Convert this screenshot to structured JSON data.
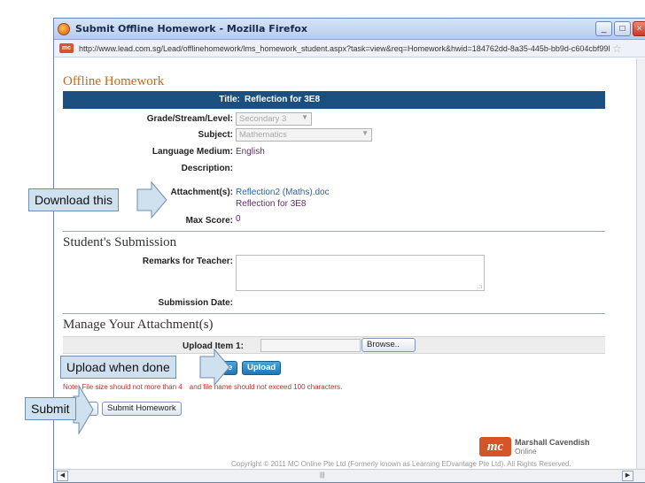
{
  "window": {
    "title": "Submit Offline Homework - Mozilla Firefox",
    "minimize_glyph": "_",
    "maximize_glyph": "□",
    "close_glyph": "×"
  },
  "address": {
    "site_badge": "mc",
    "url": "http://www.lead.com.sg/Lead/offlinehomework/lms_homework_student.aspx?task=view&req=Homework&hwid=184762dd-8a35-445b-bb9d-c604cbf99l",
    "star_glyph": "☆"
  },
  "offline": {
    "heading": "Offline Homework",
    "title_label": "Title:",
    "title_value": "Reflection for 3E8",
    "grade_label": "Grade/Stream/Level:",
    "grade_value": "Secondary 3",
    "subject_label": "Subject:",
    "subject_value": "Mathematics",
    "language_label": "Language Medium:",
    "language_value": "English",
    "description_label": "Description:",
    "attachment_label": "Attachment(s):",
    "attachment_link": "Reflection2 (Maths).doc",
    "attachment_caption": "Reflection for 3E8",
    "maxscore_label": "Max Score:",
    "maxscore_value": "0"
  },
  "submission": {
    "heading": "Student's Submission",
    "remarks_label": "Remarks for Teacher:",
    "remarks_value": "",
    "resize_glyph": ".:i",
    "date_label": "Submission Date:"
  },
  "manage": {
    "heading": "Manage Your Attachment(s)",
    "upload_item_label": "Upload Item 1:",
    "browse_label": "Browse..",
    "remove_label": "e",
    "upload_label": "Upload",
    "note_before": "Note: File size should not more than 4",
    "note_after": "and file name should not exceed 100 characters.",
    "submit_label": "Submit Homework"
  },
  "footer": {
    "logo_mark": "mc",
    "brand_line1": "Marshall Cavendish",
    "brand_line2": "Online",
    "copyright": "Copyright © 2011 MC Online Pte Ltd (Formerly known as Learning EDvantage Pte Ltd). All Rights Reserved."
  },
  "scroll": {
    "left_glyph": "◀",
    "right_glyph": "▶",
    "grip_glyph": "|||"
  },
  "callouts": {
    "download": "Download this",
    "upload": "Upload when done",
    "submit": "Submit"
  },
  "colors": {
    "accent_orange": "#c9671c",
    "header_blue": "#1b4f80",
    "link_blue": "#2b63a8",
    "value_purple": "#5a2e63",
    "note_red": "#cc2b2b",
    "callout_fill": "#cfe0ef"
  }
}
